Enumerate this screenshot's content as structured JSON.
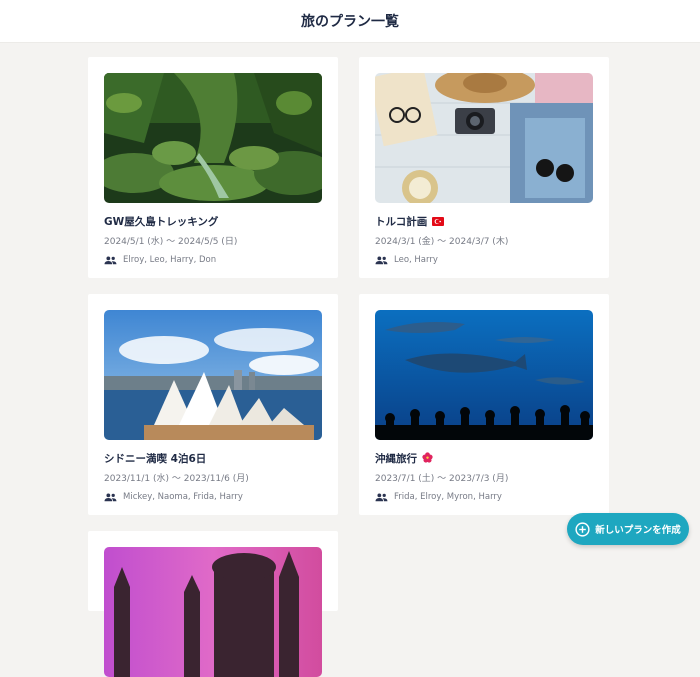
{
  "header": {
    "title": "旅のプラン一覧"
  },
  "plans": [
    {
      "title": "GW屋久島トレッキング",
      "dates": "2024/5/1 (水) 〜 2024/5/5 (日)",
      "members": "Elroy, Leo, Harry, Don",
      "image": "forest",
      "flag": ""
    },
    {
      "title": "トルコ計画",
      "dates": "2024/3/1 (金) 〜 2024/3/7 (木)",
      "members": "Leo, Harry",
      "image": "travel-flatlay",
      "flag": "turkey-flag"
    },
    {
      "title": "シドニー満喫 4泊6日",
      "dates": "2023/11/1 (水) 〜 2023/11/6 (月)",
      "members": "Mickey, Naoma, Frida, Harry",
      "image": "sydney-opera",
      "flag": ""
    },
    {
      "title": "沖縄旅行",
      "dates": "2023/7/1 (土) 〜 2023/7/3 (月)",
      "members": "Frida, Elroy, Myron, Harry",
      "image": "aquarium",
      "flag": "hibiscus"
    }
  ],
  "fab": {
    "label": "新しいプランを作成",
    "icon": "plus-circle-icon"
  },
  "colors": {
    "accent": "#1ea7c0",
    "title": "#1f2a44",
    "muted": "#777b86",
    "background": "#f4f3f1"
  }
}
